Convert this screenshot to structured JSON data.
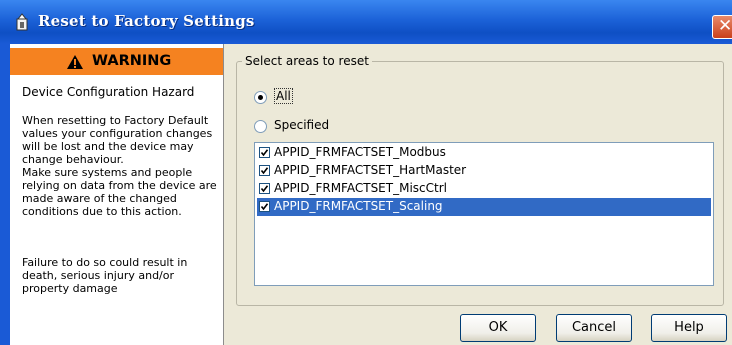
{
  "window": {
    "title": "Reset to Factory Settings"
  },
  "warning": {
    "banner": "WARNING",
    "heading": "Device Configuration Hazard",
    "lines_1": [
      "When resetting to Factory Default",
      "values your configuration changes",
      "will be lost and the device may",
      "change behaviour.",
      "Make sure systems and people",
      "relying on data from the device are",
      "made aware of the changed",
      "conditions due to this action."
    ],
    "lines_2": [
      "Failure to do so could result in",
      "death, serious injury and/or",
      "property damage"
    ]
  },
  "group": {
    "legend": "Select areas to reset",
    "options": [
      {
        "label": "All",
        "selected": true
      },
      {
        "label": "Specified",
        "selected": false
      }
    ]
  },
  "list": {
    "items": [
      {
        "label": "APPID_FRMFACTSET_Modbus",
        "checked": true,
        "selected": false
      },
      {
        "label": "APPID_FRMFACTSET_HartMaster",
        "checked": true,
        "selected": false
      },
      {
        "label": "APPID_FRMFACTSET_MiscCtrl",
        "checked": true,
        "selected": false
      },
      {
        "label": "APPID_FRMFACTSET_Scaling",
        "checked": true,
        "selected": true
      }
    ]
  },
  "buttons": {
    "ok": "OK",
    "cancel": "Cancel",
    "help": "Help"
  },
  "colors": {
    "titlebar": "#0e4fc4",
    "warning_banner": "#f58220",
    "selection": "#316ac5",
    "dialog_bg": "#ece9d8"
  }
}
